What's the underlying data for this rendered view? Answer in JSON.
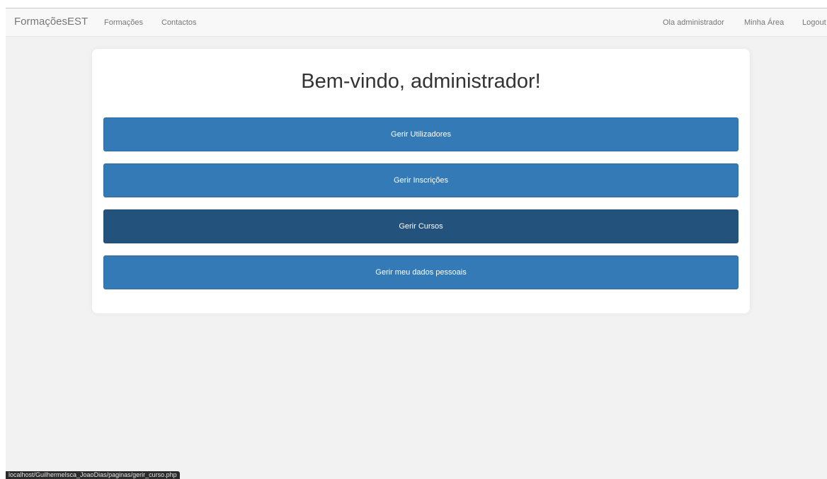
{
  "navbar": {
    "brand": "FormaçõesEST",
    "left_links": [
      "Formações",
      "Contactos"
    ],
    "greeting": "Ola administrador",
    "my_area": "Minha Área",
    "logout": "Logout"
  },
  "main": {
    "heading": "Bem-vindo, administrador!",
    "buttons": [
      {
        "label": "Gerir Utilizadores"
      },
      {
        "label": "Gerir Inscrições"
      },
      {
        "label": "Gerir Cursos",
        "state": "hover"
      },
      {
        "label": "Gerir meu dados pessoais"
      }
    ]
  },
  "status_bar": {
    "url": "localhost/GuilhermeIsca_JoaoDias/paginas/gerir_curso.php"
  },
  "colors": {
    "primary": "#337ab7",
    "primary_hover": "#23527c",
    "page_background": "#f2f2f2",
    "navbar_background": "#f8f8f8"
  }
}
